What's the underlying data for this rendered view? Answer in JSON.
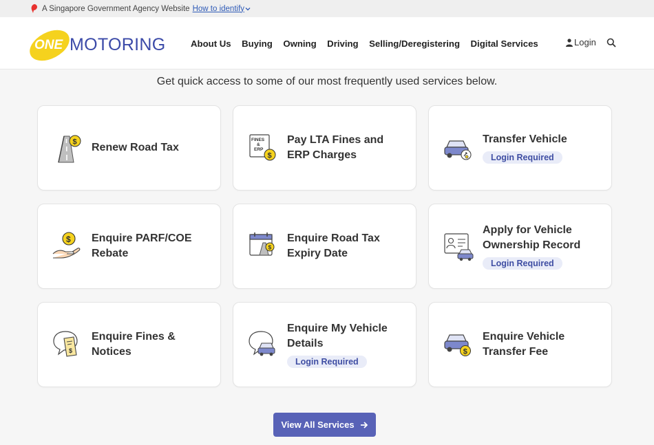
{
  "gov_banner": {
    "text": "A Singapore Government Agency Website",
    "link": "How to identify"
  },
  "brand": {
    "one": "ONE",
    "motoring": "MOTORING",
    "accent": "#f5d21e",
    "primary": "#3b4aa8"
  },
  "nav": {
    "items": [
      "About Us",
      "Buying",
      "Owning",
      "Driving",
      "Selling/Deregistering",
      "Digital Services"
    ],
    "login": "Login",
    "icons": {
      "login": "user-icon",
      "search": "search-icon"
    }
  },
  "intro": "Get quick access to some of our most frequently used services below.",
  "services": [
    {
      "title": "Renew Road Tax",
      "badge": "",
      "icon": "road-dollar-icon"
    },
    {
      "title": "Pay LTA Fines and ERP Charges",
      "badge": "",
      "icon": "fines-erp-icon"
    },
    {
      "title": "Transfer Vehicle",
      "badge": "Login Required",
      "icon": "car-transfer-icon"
    },
    {
      "title": "Enquire PARF/COE Rebate",
      "badge": "",
      "icon": "hand-dollar-icon"
    },
    {
      "title": "Enquire Road Tax Expiry Date",
      "badge": "",
      "icon": "calendar-road-icon"
    },
    {
      "title": "Apply for Vehicle Ownership Record",
      "badge": "Login Required",
      "icon": "id-card-car-icon"
    },
    {
      "title": "Enquire Fines & Notices",
      "badge": "",
      "icon": "chat-receipt-icon"
    },
    {
      "title": "Enquire My Vehicle Details",
      "badge": "Login Required",
      "icon": "chat-car-icon"
    },
    {
      "title": "Enquire Vehicle Transfer Fee",
      "badge": "",
      "icon": "car-dollar-icon"
    }
  ],
  "view_all": "View All Services",
  "colors": {
    "button": "#5862b7",
    "badge_bg": "#e9ecf8",
    "badge_text": "#3f4ea3"
  }
}
